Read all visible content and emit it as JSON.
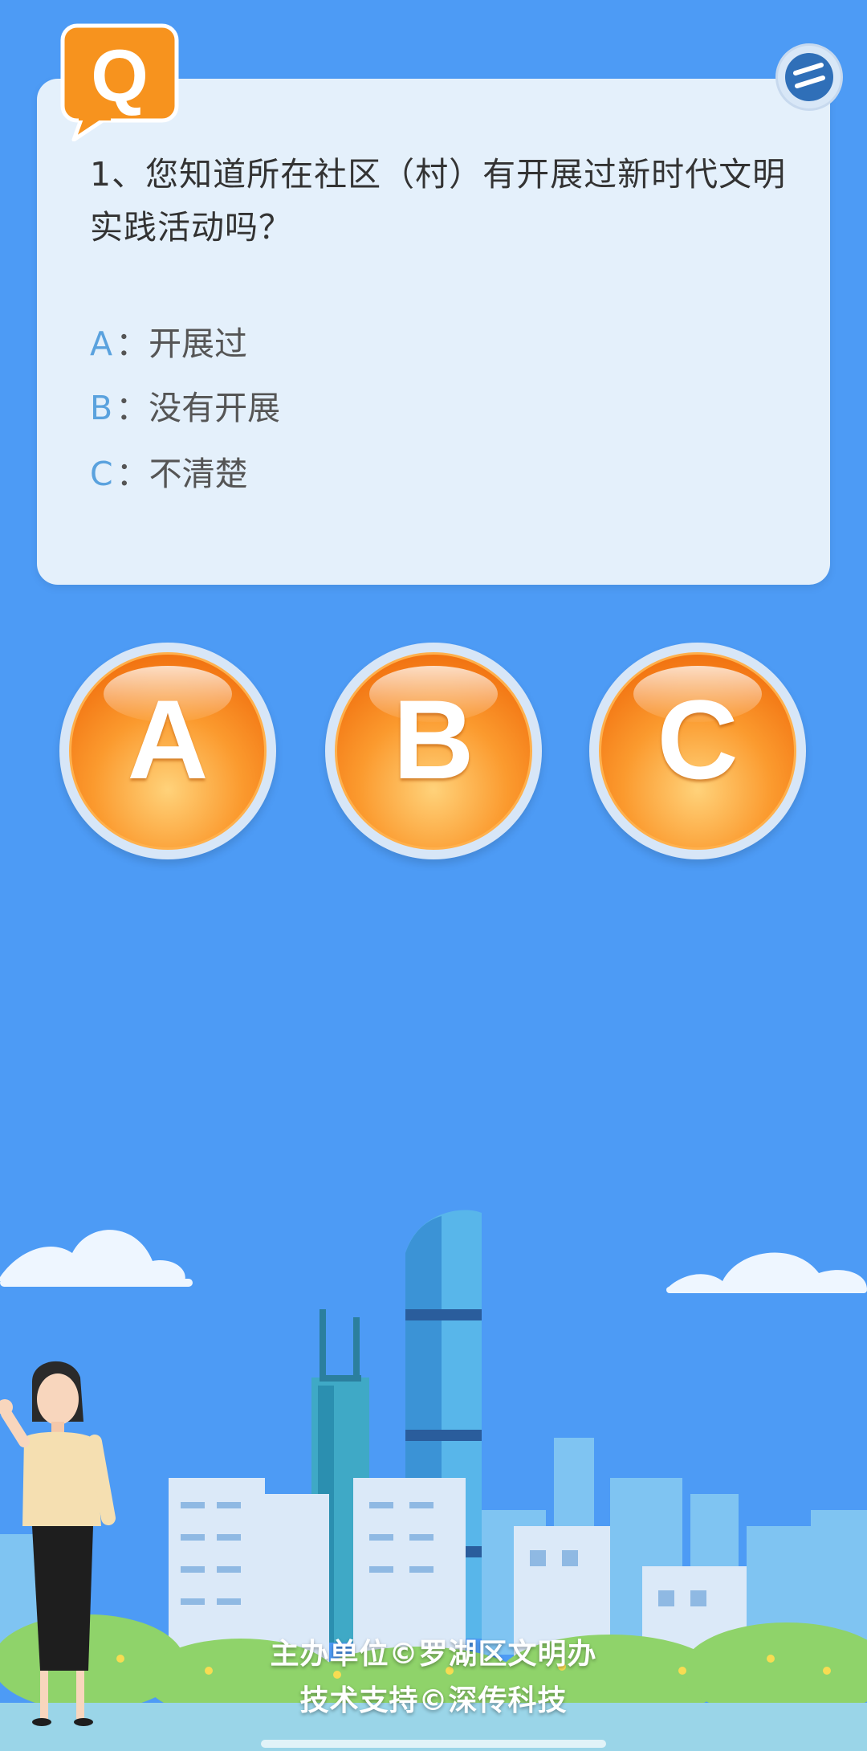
{
  "question": {
    "badge_letter": "Q",
    "text": "1、您知道所在社区（村）有开展过新时代文明实践活动吗？",
    "options": [
      {
        "letter": "A",
        "separator": "：",
        "text": "开展过"
      },
      {
        "letter": "B",
        "separator": "：",
        "text": "没有开展"
      },
      {
        "letter": "C",
        "separator": "：",
        "text": "不清楚"
      }
    ]
  },
  "answers": [
    {
      "label": "A"
    },
    {
      "label": "B"
    },
    {
      "label": "C"
    }
  ],
  "footer": {
    "organizer": "主办单位©罗湖区文明办",
    "tech_support": "技术支持©深传科技"
  },
  "colors": {
    "background": "#4d9bf5",
    "card": "#e4f0fb",
    "option_letter": "#5aa2de",
    "answer_orange": "#f27412",
    "badge_orange": "#f7931e"
  },
  "icons": {
    "question_badge": "q-speech-bubble-icon",
    "menu": "menu-icon"
  }
}
